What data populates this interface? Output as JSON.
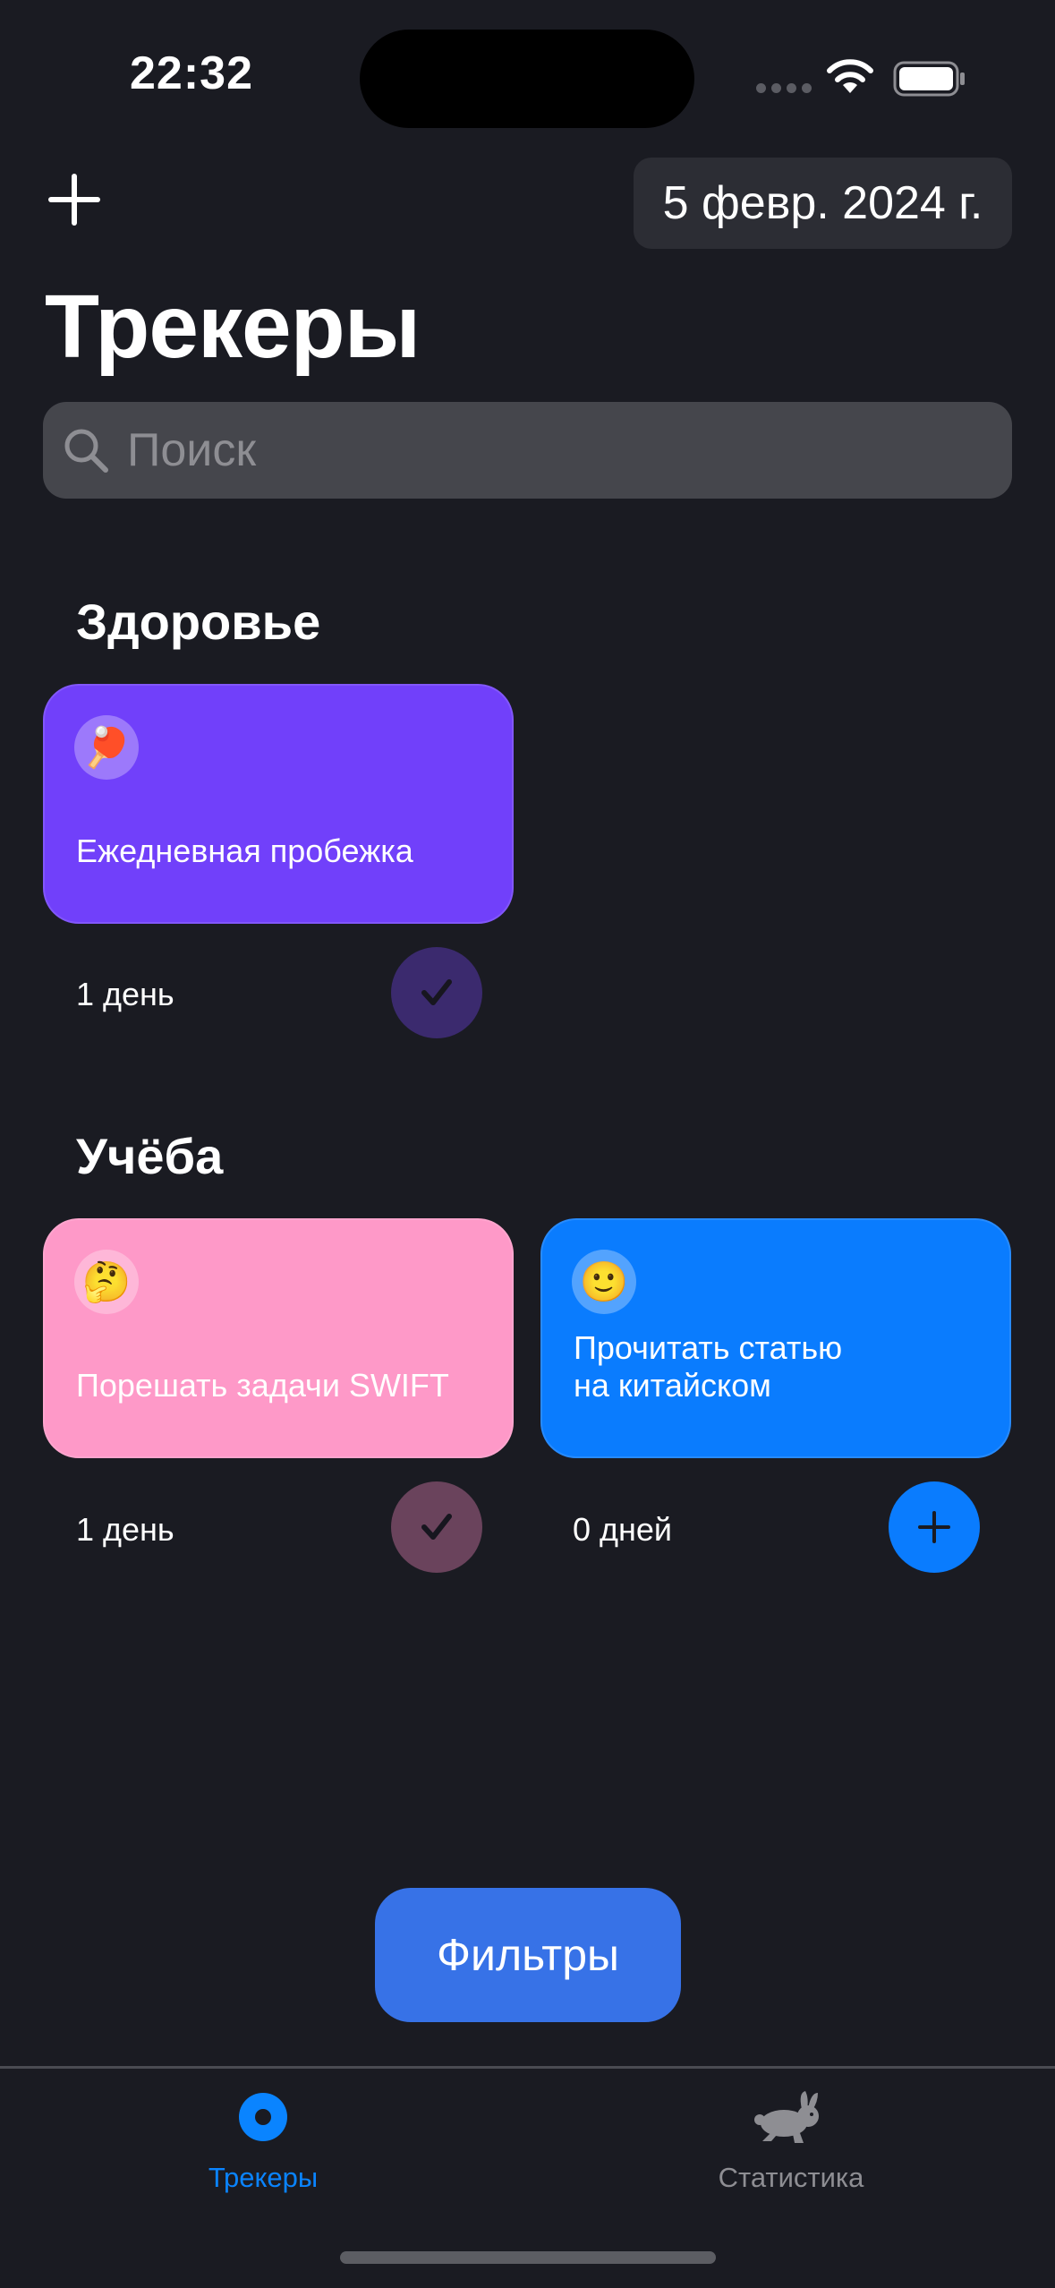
{
  "status_bar": {
    "time": "22:32"
  },
  "header": {
    "date": "5 февр. 2024 г.",
    "title": "Трекеры"
  },
  "search": {
    "placeholder": "Поиск"
  },
  "sections": [
    {
      "title": "Здоровье",
      "trackers": [
        {
          "emoji": "🏓",
          "title": "Ежедневная пробежка",
          "days": "1 день",
          "completed": true,
          "color": "#7140fa",
          "button_color": "#3b2a6e"
        }
      ]
    },
    {
      "title": "Учёба",
      "trackers": [
        {
          "emoji": "🤔",
          "title": "Порешать задачи SWIFT",
          "days": "1 день",
          "completed": true,
          "color": "#fe99c8",
          "button_color": "#6a435c"
        },
        {
          "emoji": "🙂",
          "title": "Прочитать статью\nна китайском",
          "days": "0 дней",
          "completed": false,
          "color": "#0a7cfe",
          "button_color": "#0a7cfe"
        }
      ]
    }
  ],
  "filter_button": {
    "label": "Фильтры",
    "color": "#3772e7"
  },
  "tabbar": {
    "tabs": [
      {
        "label": "Трекеры",
        "icon": "tracker-dot-icon",
        "active": true,
        "color": "#0a84ff"
      },
      {
        "label": "Статистика",
        "icon": "rabbit-icon",
        "active": false,
        "color": "#8e8e93"
      }
    ]
  }
}
